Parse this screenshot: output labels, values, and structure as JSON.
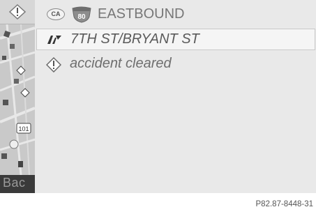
{
  "header": {
    "state_badge": "CA",
    "highway_number": "80",
    "direction": "EASTBOUND"
  },
  "messages": [
    {
      "icon": "traffic-report-icon",
      "text": "7TH ST/BRYANT ST"
    },
    {
      "icon": "warning-diamond-icon",
      "text": "accident cleared"
    }
  ],
  "map": {
    "route_shield": "101",
    "back_label": "Bac"
  },
  "footer": {
    "reference": "P82.87-8448-31"
  }
}
